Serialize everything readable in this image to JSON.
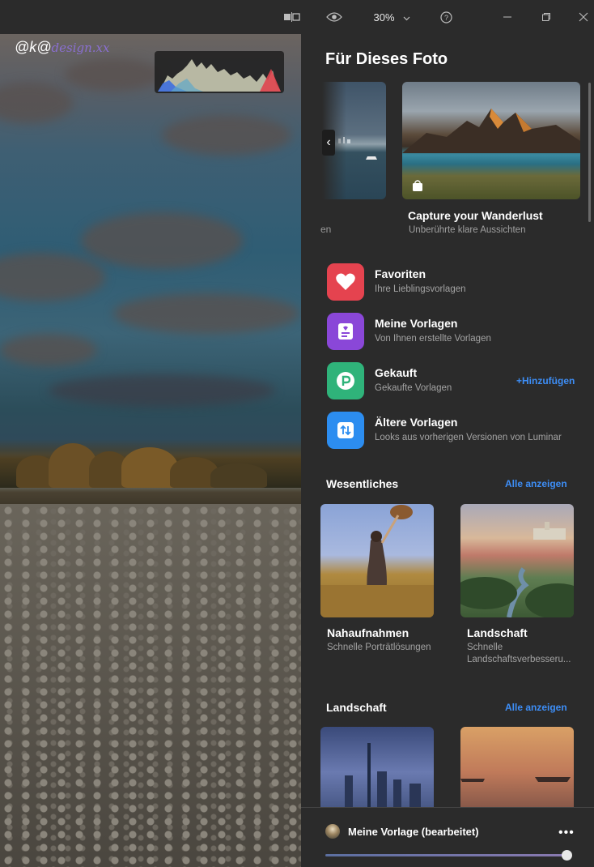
{
  "titlebar": {
    "zoom": "30%",
    "icons": [
      "compare-icon",
      "eye-icon",
      "chevron-down-icon",
      "help-icon",
      "minimize-icon",
      "maximize-icon",
      "close-icon"
    ]
  },
  "canvas": {
    "watermark_left": "@k@",
    "watermark_right": "design.xx"
  },
  "panel": {
    "title": "Für Dieses Foto",
    "prev_caption": "en",
    "featured": {
      "title": "Capture your Wanderlust",
      "subtitle": "Unberührte klare Aussichten"
    },
    "menu": [
      {
        "label": "Favoriten",
        "desc": "Ihre Lieblingsvorlagen",
        "color": "#e5434f",
        "icon": "heart-icon"
      },
      {
        "label": "Meine Vorlagen",
        "desc": "Von Ihnen erstellte Vorlagen",
        "color": "#8a47d8",
        "icon": "user-template-icon"
      },
      {
        "label": "Gekauft",
        "desc": "Gekaufte Vorlagen",
        "color": "#2fb37a",
        "icon": "purchased-icon"
      },
      {
        "label": "Ältere Vorlagen",
        "desc": "Looks aus vorherigen Versionen von Luminar",
        "color": "#2c8df0",
        "icon": "legacy-icon"
      }
    ],
    "add_label": "+Hinzufügen",
    "sections": [
      {
        "title": "Wesentliches",
        "link": "Alle anzeigen",
        "items": [
          {
            "title": "Nahaufnahmen",
            "sub": "Schnelle Porträtlösungen"
          },
          {
            "title": "Landschaft",
            "sub": "Schnelle Landschaftsverbesseru..."
          }
        ]
      },
      {
        "title": "Landschaft",
        "link": "Alle anzeigen",
        "items": [
          {
            "title": "",
            "sub": ""
          },
          {
            "title": "",
            "sub": ""
          }
        ]
      }
    ],
    "bottom": {
      "preset_name": "Meine Vorlage (bearbeitet)",
      "more": "•••",
      "amount": 1.0
    }
  }
}
